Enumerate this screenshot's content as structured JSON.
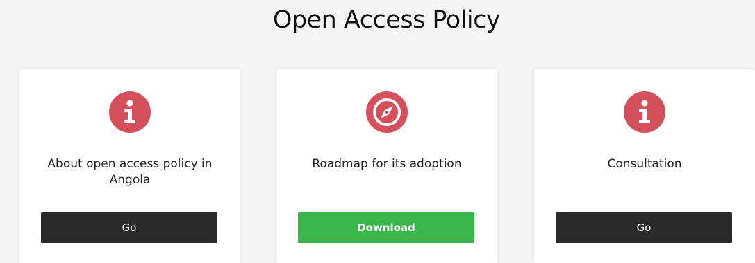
{
  "page": {
    "title": "Open Access Policy"
  },
  "colors": {
    "icon_red": "#d4505a",
    "button_dark": "#2a2a2a",
    "button_green": "#3ab54a"
  },
  "cards": [
    {
      "icon": "info-icon",
      "text": "About open access policy in Angola",
      "button_label": "Go"
    },
    {
      "icon": "compass-icon",
      "text": "Roadmap for its adoption",
      "button_label": "Download"
    },
    {
      "icon": "info-icon",
      "text": "Consultation",
      "button_label": "Go"
    }
  ]
}
